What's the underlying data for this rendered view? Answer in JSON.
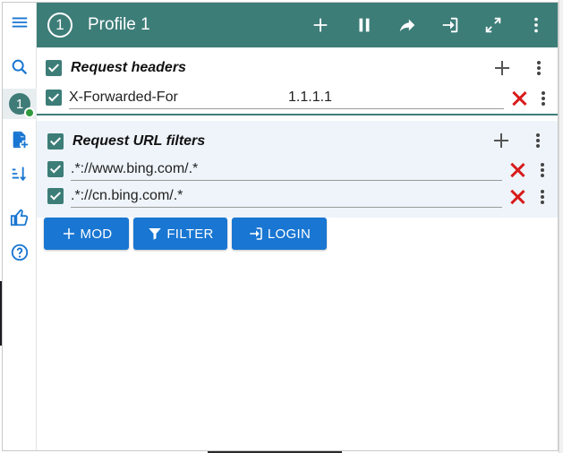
{
  "colors": {
    "accent": "#3d7d78",
    "button": "#1976d2",
    "delete": "#d81b1b"
  },
  "header": {
    "profile_number": "1",
    "title": "Profile 1",
    "icons": [
      "plus-icon",
      "pause-icon",
      "share-icon",
      "login-icon",
      "fullscreen-icon",
      "more-vert-icon"
    ]
  },
  "rail": {
    "profile_number": "1",
    "icons": [
      "menu-icon",
      "search-icon",
      "profile-icon",
      "add-file-icon",
      "sort-icon",
      "thumbs-up-icon",
      "help-icon"
    ]
  },
  "request_headers": {
    "title": "Request headers",
    "rows": [
      {
        "name": "X-Forwarded-For",
        "value": "1.1.1.1"
      }
    ]
  },
  "url_filters": {
    "title": "Request URL filters",
    "rows": [
      {
        "value": ".*://www.bing.com/.*"
      },
      {
        "value": ".*://cn.bing.com/.*"
      }
    ]
  },
  "buttons": {
    "mod": "MOD",
    "filter": "FILTER",
    "login": "LOGIN"
  }
}
